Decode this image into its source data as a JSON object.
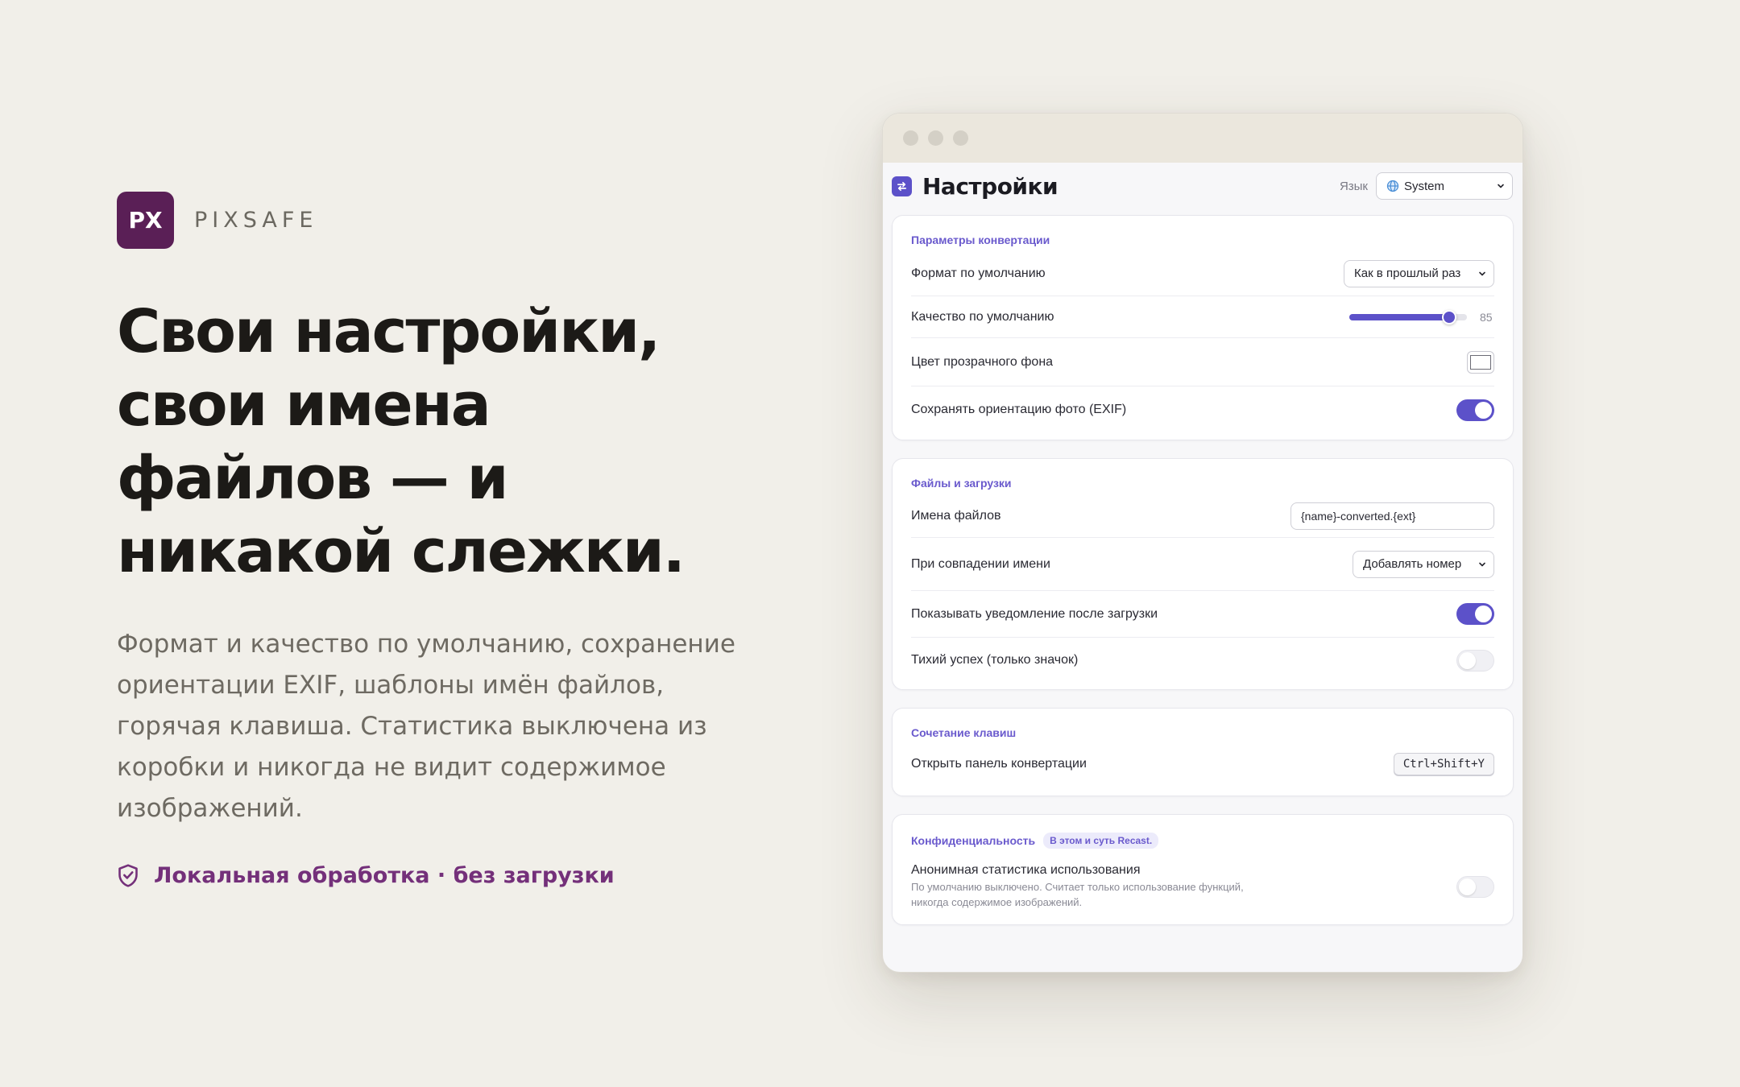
{
  "brand": {
    "logo_text": "PX",
    "name": "PIXSAFE",
    "logo_color": "#5a1f56"
  },
  "hero": {
    "headline_lines": [
      "Свои настройки,",
      "свои имена",
      "файлов — и",
      "никакой слежки."
    ],
    "description": "Формат и качество по умолчанию, сохранение ориентации EXIF, шаблоны имён файлов, горячая клавиша. Статистика выключена из коробки и никогда не видит содержимое изображений.",
    "badge_icon": "shield-check-icon",
    "badge_text": "Локальная обработка · без загрузки",
    "badge_color": "#74307a"
  },
  "window": {
    "title": "Настройки",
    "app_icon": "swap-icon",
    "accent": "#5c51c9",
    "language": {
      "label": "Язык",
      "value": "System",
      "icon": "globe-icon"
    }
  },
  "sections": {
    "conversion": {
      "title": "Параметры конвертации",
      "default_format": {
        "label": "Формат по умолчанию",
        "value": "Как в прошлый раз"
      },
      "default_quality": {
        "label": "Качество по умолчанию",
        "value": 85,
        "min": 0,
        "max": 100
      },
      "background_color": {
        "label": "Цвет прозрачного фона",
        "value": "#ffffff"
      },
      "keep_orientation": {
        "label": "Сохранять ориентацию фото (EXIF)",
        "on": true
      }
    },
    "files": {
      "title": "Файлы и загрузки",
      "file_names": {
        "label": "Имена файлов",
        "value": "{name}-converted.{ext}"
      },
      "on_conflict": {
        "label": "При совпадении имени",
        "value": "Добавлять номер"
      },
      "notify_after_download": {
        "label": "Показывать уведомление после загрузки",
        "on": true
      },
      "silent_success": {
        "label": "Тихий успех (только значок)",
        "on": false
      }
    },
    "shortcuts": {
      "title": "Сочетание клавиш",
      "open_panel": {
        "label": "Открыть панель конвертации",
        "value": "Ctrl+Shift+Y"
      }
    },
    "privacy": {
      "title": "Конфиденциальность",
      "badge": "В этом и суть Recast.",
      "anonymous_stats": {
        "label": "Анонимная статистика использования",
        "description": "По умолчанию выключено. Считает только использование функций, никогда содержимое изображений.",
        "on": false
      }
    }
  }
}
